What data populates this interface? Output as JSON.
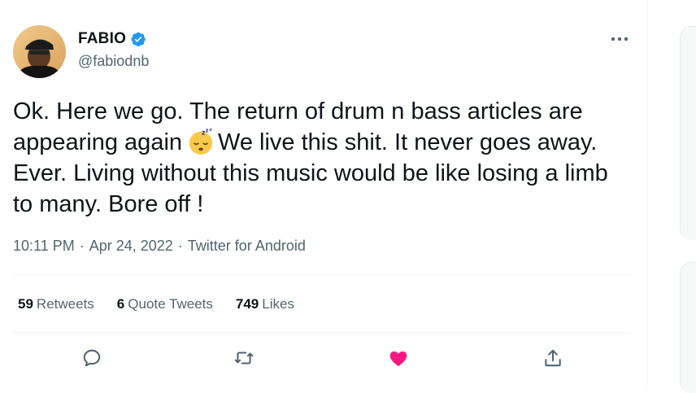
{
  "author": {
    "display_name": "FABIO",
    "handle": "@fabiodnb",
    "verified": true
  },
  "tweet": {
    "text_part1": "Ok. Here we go. The return of drum n bass articles are appearing again",
    "emoji": "sleeping-face-emoji",
    "text_part2": "We live this shit. It never goes away. Ever. Living without this music would be like losing a limb to many. Bore off !"
  },
  "meta": {
    "time": "10:11 PM",
    "separator": "·",
    "date": "Apr 24, 2022",
    "source": "Twitter for Android"
  },
  "stats": {
    "retweets_count": "59",
    "retweets_label": "Retweets",
    "quote_count": "6",
    "quote_label": "Quote Tweets",
    "likes_count": "749",
    "likes_label": "Likes"
  },
  "actions": {
    "icons": [
      "reply-icon",
      "retweet-icon",
      "like-icon",
      "share-icon"
    ],
    "liked": true
  },
  "colors": {
    "text": "#0f1419",
    "secondary": "#536471",
    "verified": "#1d9bf0",
    "like": "#f91880",
    "divider": "#eff3f4"
  }
}
